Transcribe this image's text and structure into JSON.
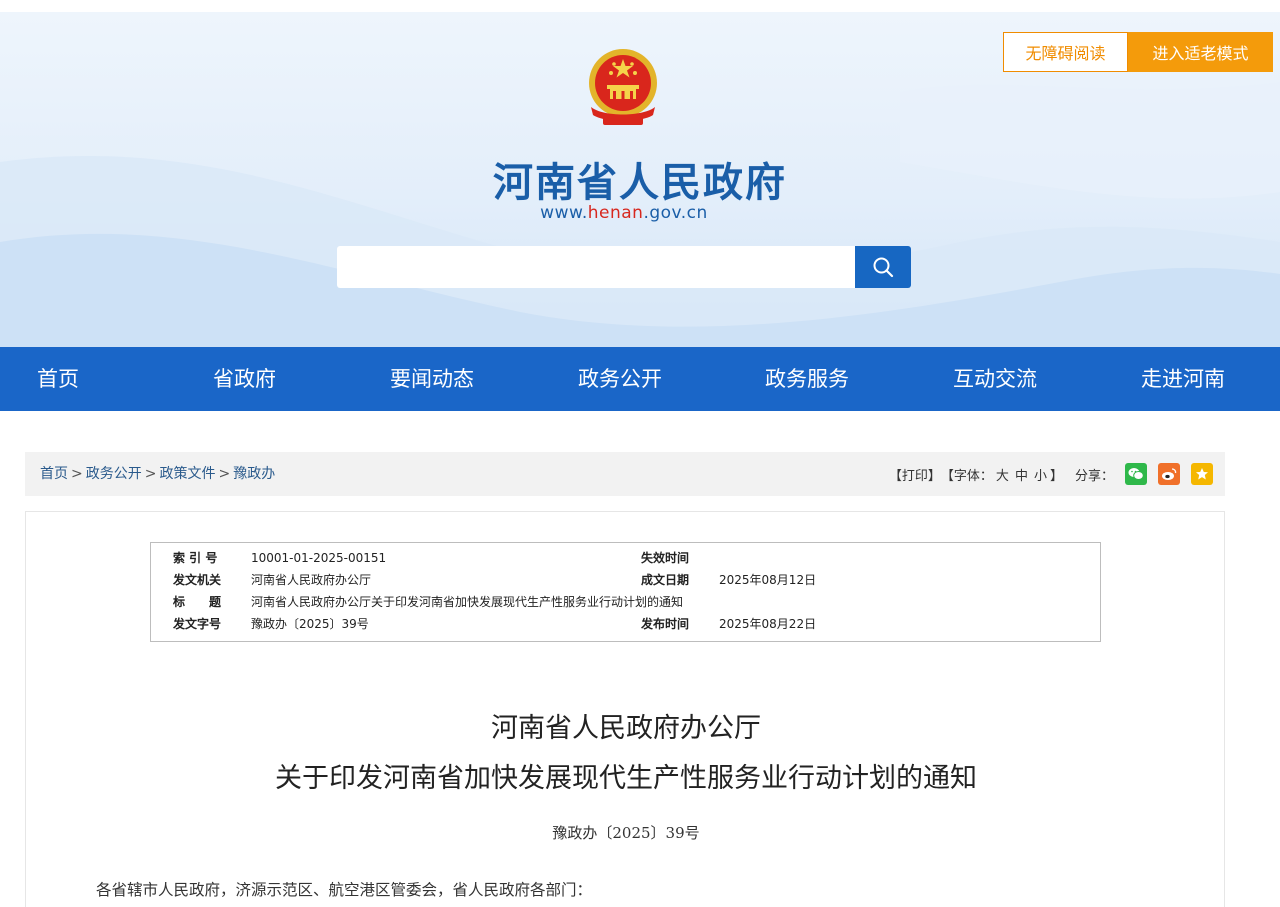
{
  "header": {
    "site_name": "河南省人民政府",
    "url_prefix": "www.",
    "url_highlight": "henan",
    "url_suffix": ".gov.cn",
    "accessibility_button": "无障碍阅读",
    "elder_mode_button": "进入适老模式",
    "search_placeholder": ""
  },
  "nav": {
    "items": [
      {
        "label": "首页"
      },
      {
        "label": "省政府"
      },
      {
        "label": "要闻动态"
      },
      {
        "label": "政务公开"
      },
      {
        "label": "政务服务"
      },
      {
        "label": "互动交流"
      },
      {
        "label": "走进河南"
      }
    ]
  },
  "breadcrumb": {
    "items": [
      "首页",
      "政务公开",
      "政策文件",
      "豫政办"
    ],
    "separator": ">"
  },
  "tools": {
    "print": "【打印】",
    "font_label": "【字体：",
    "font_large": "大",
    "font_medium": "中",
    "font_small": "小",
    "font_close": "】",
    "share_label": "分享："
  },
  "doc_info": {
    "index_label": "索 引 号",
    "index_value": "10001-01-2025-00151",
    "expire_label": "失效时间",
    "expire_value": "",
    "issuer_label": "发文机关",
    "issuer_value": "河南省人民政府办公厅",
    "written_label": "成文日期",
    "written_value": "2025年08月12日",
    "title_label": "标　　题",
    "title_value": "河南省人民政府办公厅关于印发河南省加快发展现代生产性服务业行动计划的通知",
    "docno_label": "发文字号",
    "docno_value": "豫政办〔2025〕39号",
    "publish_label": "发布时间",
    "publish_value": "2025年08月22日"
  },
  "document": {
    "title_line1": "河南省人民政府办公厅",
    "title_line2": "关于印发河南省加快发展现代生产性服务业行动计划的通知",
    "doc_number": "豫政办〔2025〕39号",
    "salutation": "各省辖市人民政府，济源示范区、航空港区管委会，省人民政府各部门："
  },
  "colors": {
    "brand_blue": "#1a66c8",
    "title_blue": "#1a5ea8",
    "accent_orange": "#f49b0b",
    "url_red": "#d7281f",
    "wechat_green": "#2fb84a",
    "weibo_orange": "#f0702a",
    "favorite_yellow": "#f5b700"
  }
}
